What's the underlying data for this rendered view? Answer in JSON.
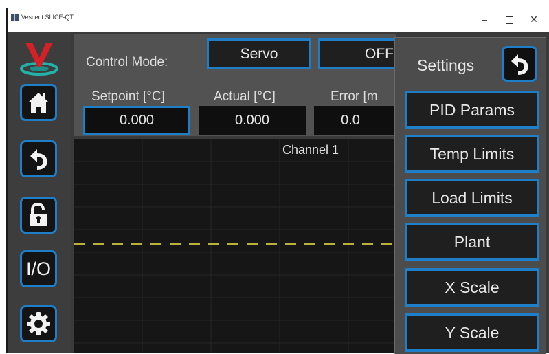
{
  "window": {
    "title": "Vescent SLICE-QT",
    "controls": {
      "minimize": "–",
      "close": "✕"
    }
  },
  "sidebar": {
    "logo": "vescent-logo",
    "buttons": [
      {
        "name": "home",
        "icon": "home-icon"
      },
      {
        "name": "back",
        "icon": "back-arrow-icon"
      },
      {
        "name": "lock",
        "icon": "unlock-icon"
      },
      {
        "name": "io",
        "label": "I/O"
      },
      {
        "name": "settings",
        "icon": "gear-icon"
      }
    ]
  },
  "control": {
    "mode_label": "Control Mode:",
    "mode_value": "Servo",
    "output_value": "OFF",
    "setpoint_label": "Setpoint [°C]",
    "setpoint_value": "0.000",
    "actual_label": "Actual [°C]",
    "actual_value": "0.000",
    "error_label": "Error [m",
    "error_value": "0.0"
  },
  "plot": {
    "title": "Channel 1"
  },
  "settings": {
    "title": "Settings",
    "back_icon": "back-arrow-icon",
    "items": [
      "PID Params",
      "Temp Limits",
      "Load Limits",
      "Plant",
      "X Scale",
      "Y Scale"
    ]
  },
  "colors": {
    "accent": "#1e7fc8",
    "panel": "#525252",
    "plot_bg": "#161616",
    "setpoint_trace": "#b9b236",
    "logo_red": "#d42026",
    "logo_teal": "#23b1a8"
  }
}
